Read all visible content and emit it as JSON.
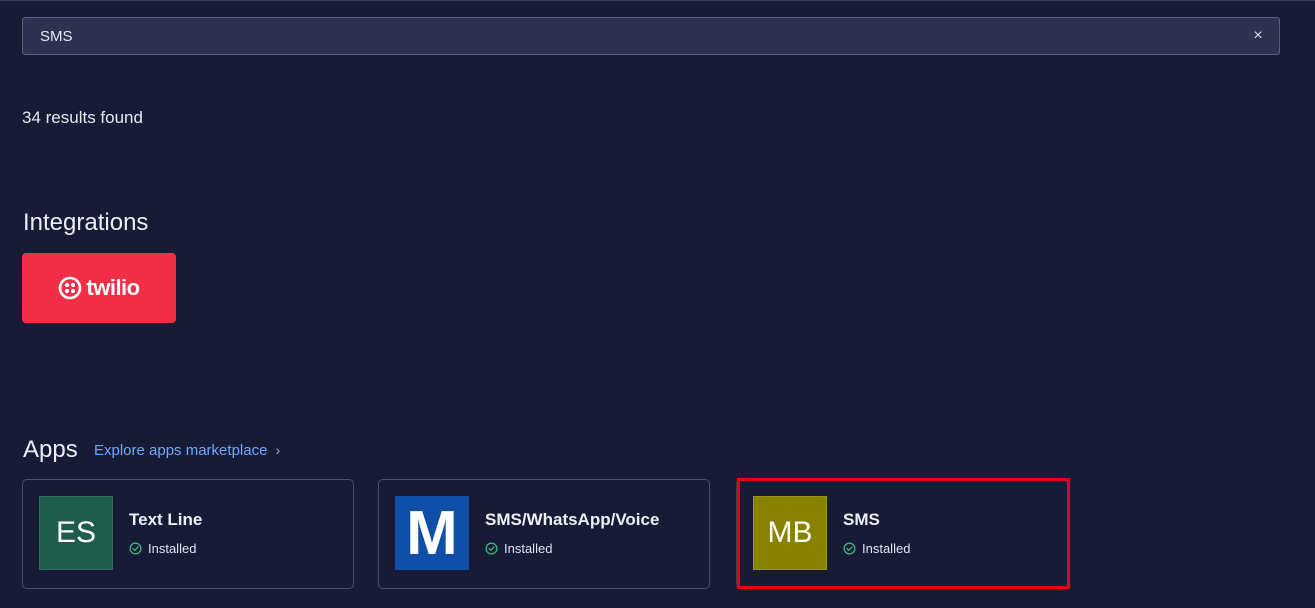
{
  "search": {
    "value": "SMS",
    "clear_icon": "×"
  },
  "results": {
    "count_text": "34 results found"
  },
  "integrations": {
    "title": "Integrations",
    "items": [
      {
        "name": "twilio",
        "color": "#f22f46"
      }
    ]
  },
  "apps": {
    "title": "Apps",
    "explore_link": "Explore apps marketplace",
    "explore_chevron": "›",
    "items": [
      {
        "logo_text": "ES",
        "name": "Text Line",
        "status": "Installed",
        "logo_color": "#1f5c4c"
      },
      {
        "logo_text": "M",
        "name": "SMS/WhatsApp/Voice",
        "status": "Installed",
        "logo_color": "#0f4fa8"
      },
      {
        "logo_text": "MB",
        "name": "SMS",
        "status": "Installed",
        "logo_color": "#878300",
        "highlighted": true
      }
    ]
  },
  "colors": {
    "background": "#181b36",
    "accent_link": "#6ea8ff",
    "installed_check": "#3fbf7f",
    "highlight": "#e60012"
  }
}
